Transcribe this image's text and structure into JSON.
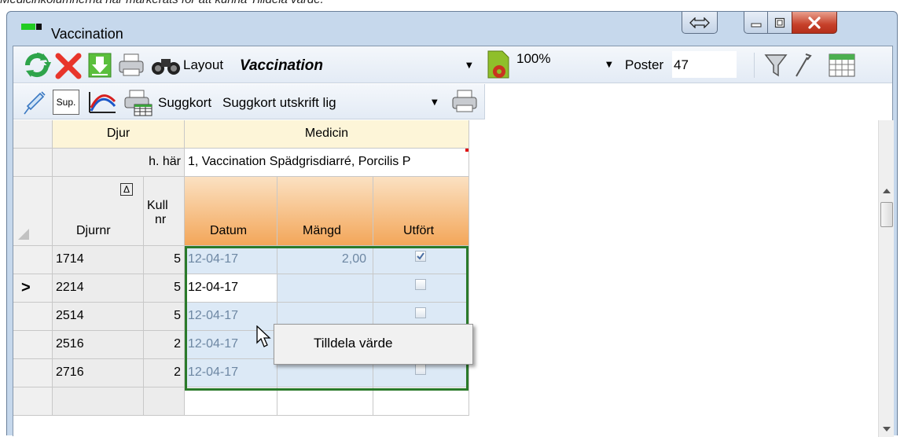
{
  "caption": "Medicinkolumnerna när markerats för att kunna Tilldela värde.",
  "window": {
    "title": "Vaccination"
  },
  "toolbar1": {
    "layout_label": "Layout",
    "layout_value": "Vaccination",
    "zoom_value": "100%",
    "poster_label": "Poster",
    "poster_value": "47"
  },
  "toolbar2": {
    "sup_label": "Sup.",
    "suggkort_label": "Suggkort",
    "suggkort_value": "Suggkort utskrift lig"
  },
  "grid": {
    "group_djur": "Djur",
    "group_medicin": "Medicin",
    "subheader_left": "h. här",
    "subheader_medicin": "1, Vaccination Spädgrisdiarré, Porcilis P",
    "col_djurnr": "Djurnr",
    "col_kull": "Kull",
    "col_kull2": "nr",
    "col_datum": "Datum",
    "col_mangd": "Mängd",
    "col_utfort": "Utfört",
    "sort_indicator": "Δ",
    "current_row_marker": ">",
    "rows": [
      {
        "djurnr": "1714",
        "kull": "5",
        "datum": "12-04-17",
        "mangd": "2,00",
        "utfort": true
      },
      {
        "djurnr": "2214",
        "kull": "5",
        "datum": "12-04-17",
        "mangd": "",
        "utfort": false
      },
      {
        "djurnr": "2514",
        "kull": "5",
        "datum": "12-04-17",
        "mangd": "",
        "utfort": false
      },
      {
        "djurnr": "2516",
        "kull": "2",
        "datum": "12-04-17",
        "mangd": "",
        "utfort": false
      },
      {
        "djurnr": "2716",
        "kull": "2",
        "datum": "12-04-17",
        "mangd": "",
        "utfort": false
      }
    ]
  },
  "context_menu": {
    "item": "Tilldela värde"
  },
  "colors": {
    "selection_border": "#2a7a2a",
    "header_orange": "#f3a659",
    "header_yellow": "#fdf5d8",
    "close_red": "#c6402a"
  }
}
